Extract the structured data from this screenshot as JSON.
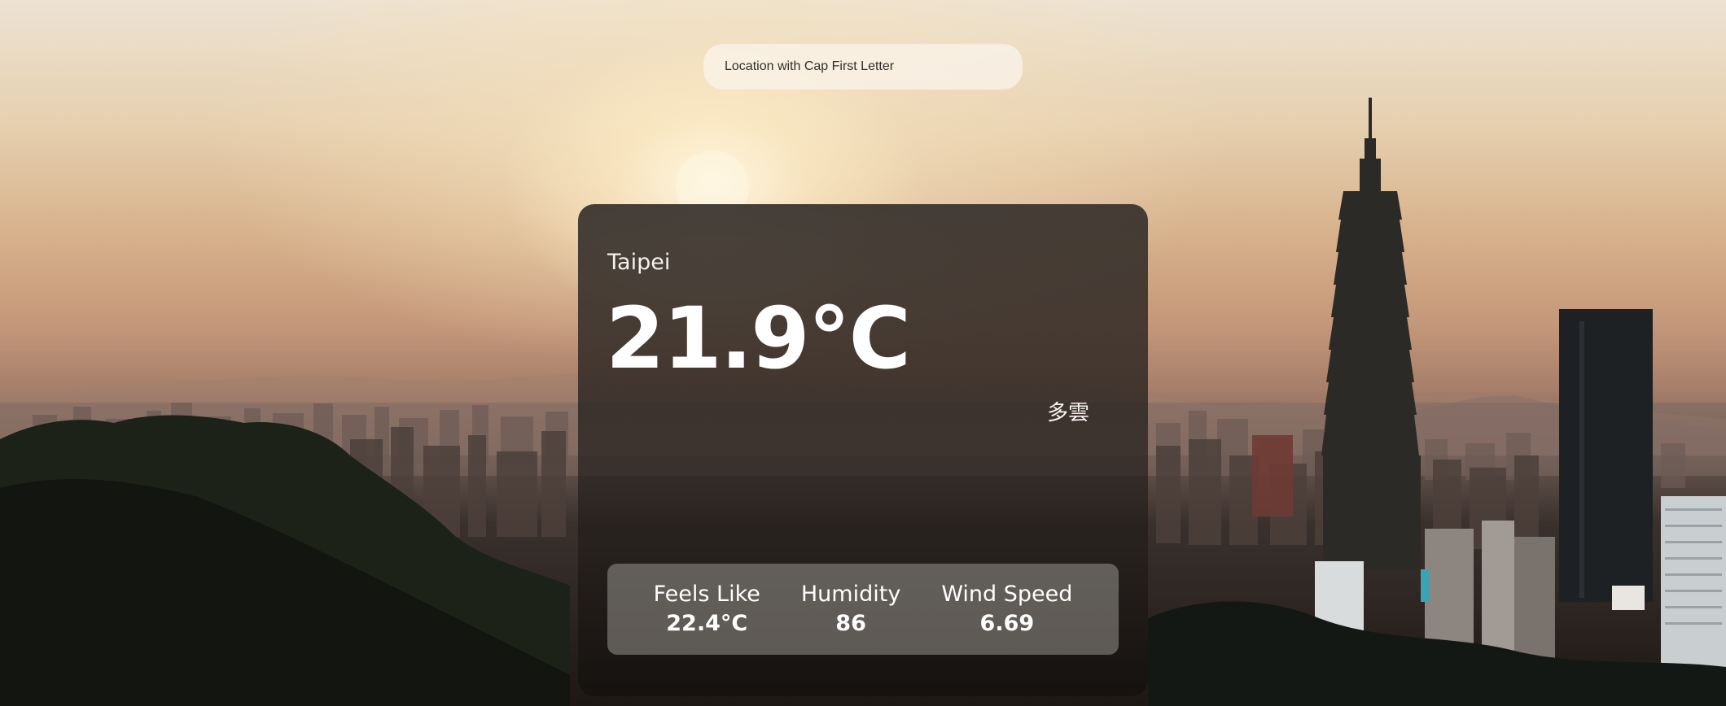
{
  "search": {
    "placeholder": "Location with Cap First Letter",
    "value": ""
  },
  "weather": {
    "city": "Taipei",
    "temperature": "21.9°C",
    "description": "多雲"
  },
  "stats": [
    {
      "label": "Feels Like",
      "value": "22.4°C"
    },
    {
      "label": "Humidity",
      "value": "86"
    },
    {
      "label": "Wind Speed",
      "value": "6.69"
    }
  ],
  "colors": {
    "card_background": "#2a2420",
    "stats_panel": "#8f8b87",
    "text": "#ffffff",
    "search_background": "#faf4ea"
  }
}
